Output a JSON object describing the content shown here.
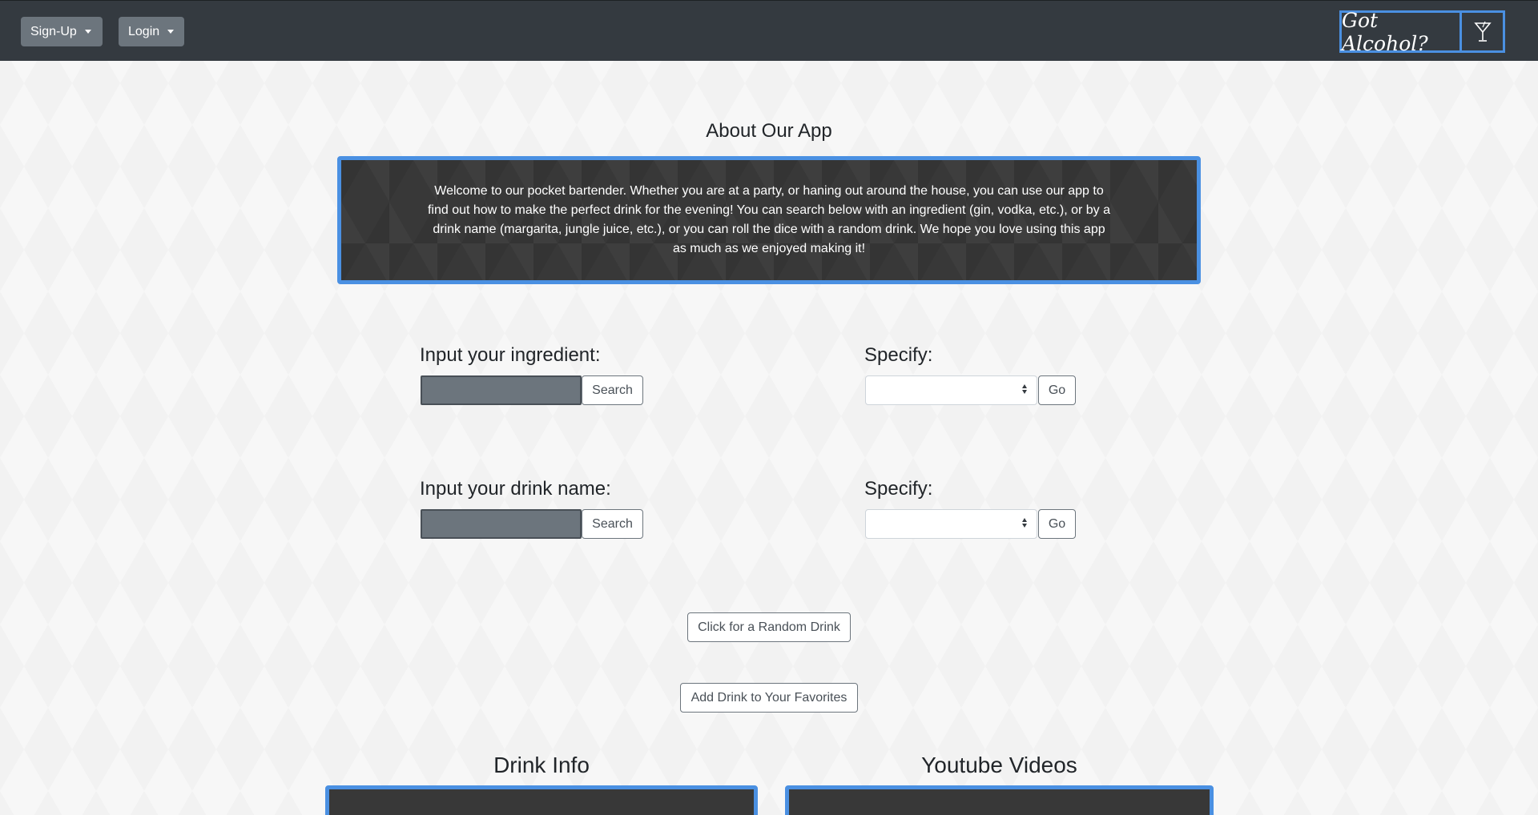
{
  "navbar": {
    "signup_label": "Sign-Up",
    "login_label": "Login",
    "brand_text": "Got Alcohol?",
    "brand_icon": "cocktail-glass-icon",
    "accent_color": "#4a90e2"
  },
  "about": {
    "title": "About Our App",
    "body": "Welcome to our pocket bartender. Whether you are at a party, or haning out around the house, you can use our app to find out how to make the perfect drink for the evening! You can search below with an ingredient (gin, vodka, etc.), or by a drink name (margarita, jungle juice, etc.), or you can roll the dice with a random drink. We hope you love using this app as much as we enjoyed making it!"
  },
  "ingredient_search": {
    "label": "Input your ingredient:",
    "value": "",
    "search_label": "Search",
    "specify_label": "Specify:",
    "specify_value": "",
    "go_label": "Go"
  },
  "drink_search": {
    "label": "Input your drink name:",
    "value": "",
    "search_label": "Search",
    "specify_label": "Specify:",
    "specify_value": "",
    "go_label": "Go"
  },
  "actions": {
    "random_label": "Click for a Random Drink",
    "favorite_label": "Add Drink to Your Favorites"
  },
  "sections": {
    "drink_info_title": "Drink Info",
    "youtube_title": "Youtube Videos"
  }
}
